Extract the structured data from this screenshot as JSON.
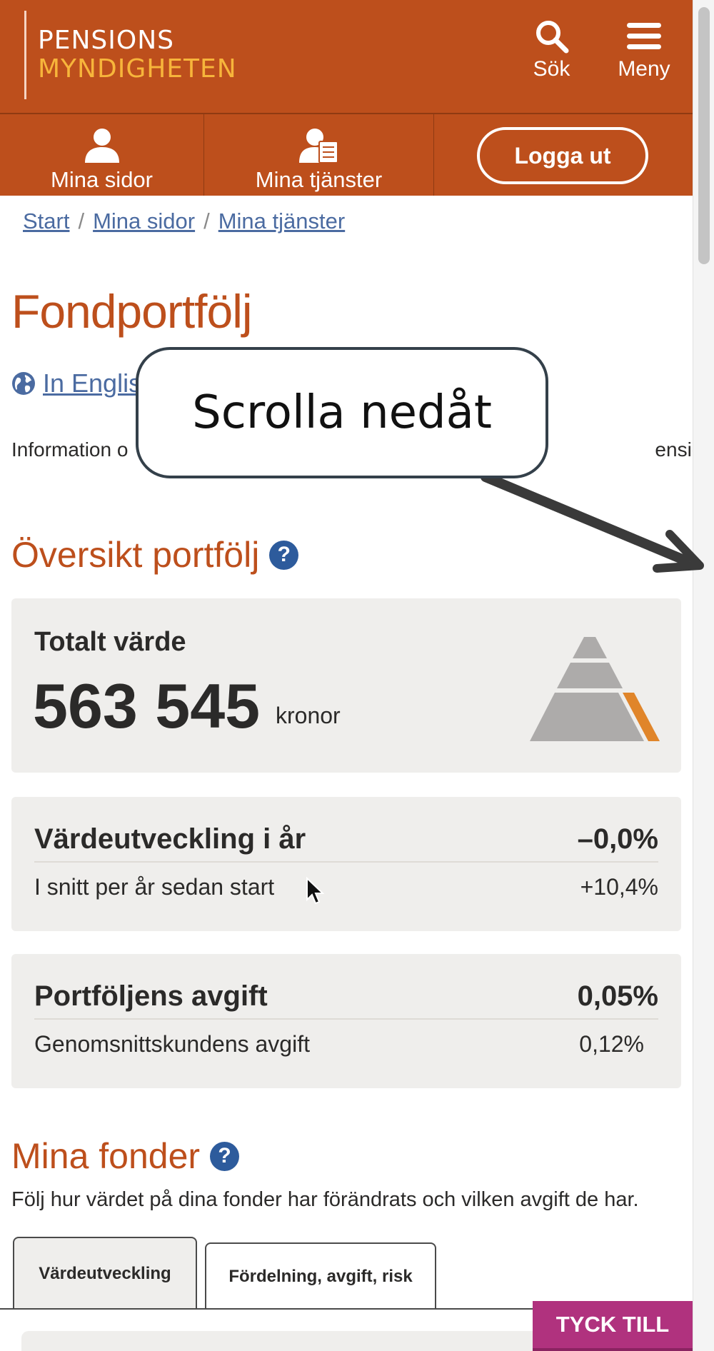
{
  "header": {
    "logo_line1": "PENSIONS",
    "logo_line2": "MYNDIGHETEN",
    "search_label": "Sök",
    "search_icon": "search-icon",
    "menu_label": "Meny",
    "menu_icon": "hamburger-icon",
    "brand_color": "#bd4f1c",
    "logo_accent_color": "#f7b53b"
  },
  "nav": {
    "my_pages": "Mina sidor",
    "my_services": "Mina tjänster",
    "logout": "Logga ut"
  },
  "breadcrumb": [
    "Start",
    "Mina sidor",
    "Mina tjänster"
  ],
  "page": {
    "title": "Fondportfölj",
    "english_link": "In English",
    "intro_visible_left": "Information o",
    "intro_visible_right": "ensionen."
  },
  "overview": {
    "heading": "Översikt portfölj",
    "total_label": "Totalt värde",
    "total_value": "563 545",
    "total_unit": "kronor",
    "development_label": "Värdeutveckling i år",
    "development_value": "–0,0%",
    "avg_label": "I snitt per år sedan start",
    "avg_value": "+10,4%",
    "fee_label": "Portföljens avgift",
    "fee_value": "0,05%",
    "avg_customer_fee_label": "Genomsnittskundens avgift",
    "avg_customer_fee_value": "0,12%"
  },
  "funds": {
    "heading": "Mina fonder",
    "subtitle": "Följ hur värdet på dina fonder har förändrats och vilken avgift de har.",
    "tabs": [
      {
        "label": "Värdeutveckling",
        "active": true
      },
      {
        "label": "Fördelning, avgift, risk",
        "active": false
      }
    ]
  },
  "feedback": {
    "label": "TYCK TILL",
    "color": "#b0327e"
  },
  "overlay": {
    "callout_text": "Scrolla nedåt"
  }
}
